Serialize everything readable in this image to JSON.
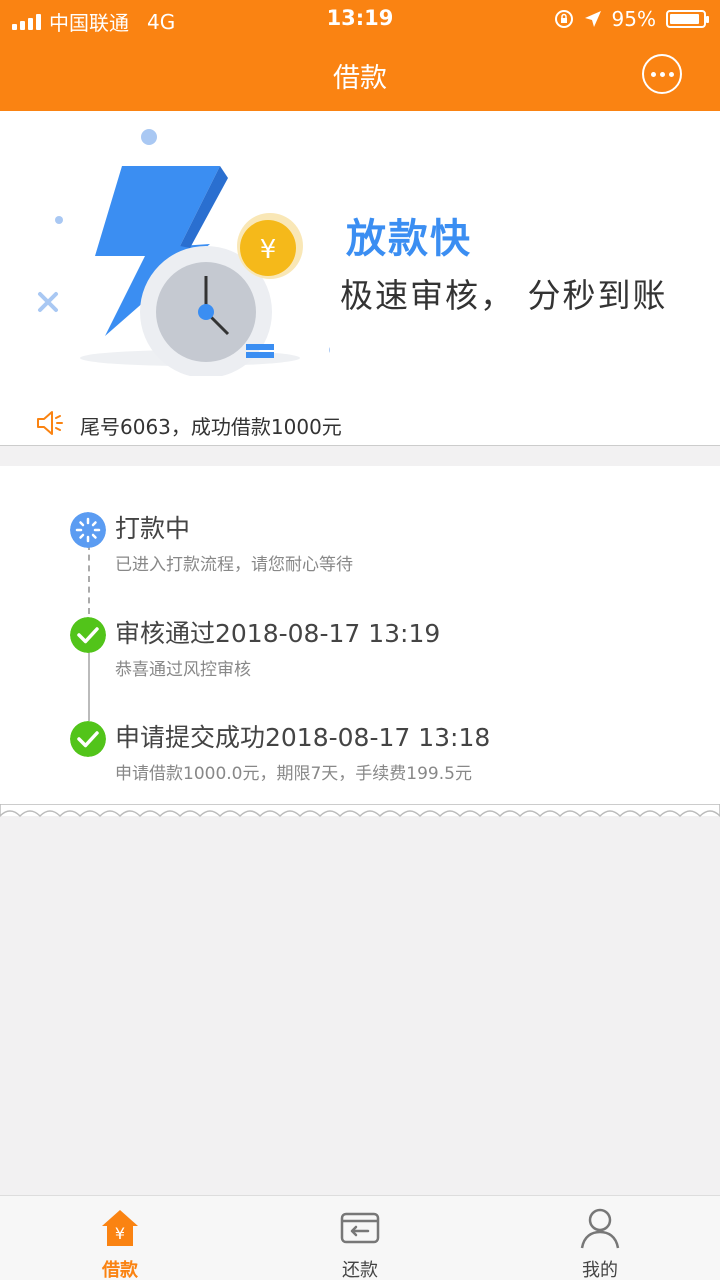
{
  "status_bar": {
    "carrier": "中国联通",
    "network": "4G",
    "time": "13:19",
    "battery": "95%"
  },
  "header": {
    "title": "借款"
  },
  "banner": {
    "title": "放款快",
    "subtitle": "极速审核， 分秒到账",
    "coin_symbol": "¥"
  },
  "notice": {
    "text": "尾号6063，成功借款1000元"
  },
  "timeline": {
    "steps": [
      {
        "title": "打款中",
        "desc": "已进入打款流程，请您耐心等待",
        "state": "pending"
      },
      {
        "title": "审核通过2018-08-17 13:19",
        "desc": "恭喜通过风控审核",
        "state": "done"
      },
      {
        "title": "申请提交成功2018-08-17 13:18",
        "desc": "申请借款1000.0元，期限7天，手续费199.5元",
        "state": "done"
      }
    ]
  },
  "tabbar": {
    "tabs": [
      {
        "label": "借款",
        "icon": "home-yuan-icon",
        "active": true
      },
      {
        "label": "还款",
        "icon": "repay-card-icon",
        "active": false
      },
      {
        "label": "我的",
        "icon": "user-icon",
        "active": false
      }
    ]
  },
  "colors": {
    "brand_orange": "#fa8312",
    "accent_blue": "#3b8ef2",
    "success_green": "#52c41a"
  }
}
